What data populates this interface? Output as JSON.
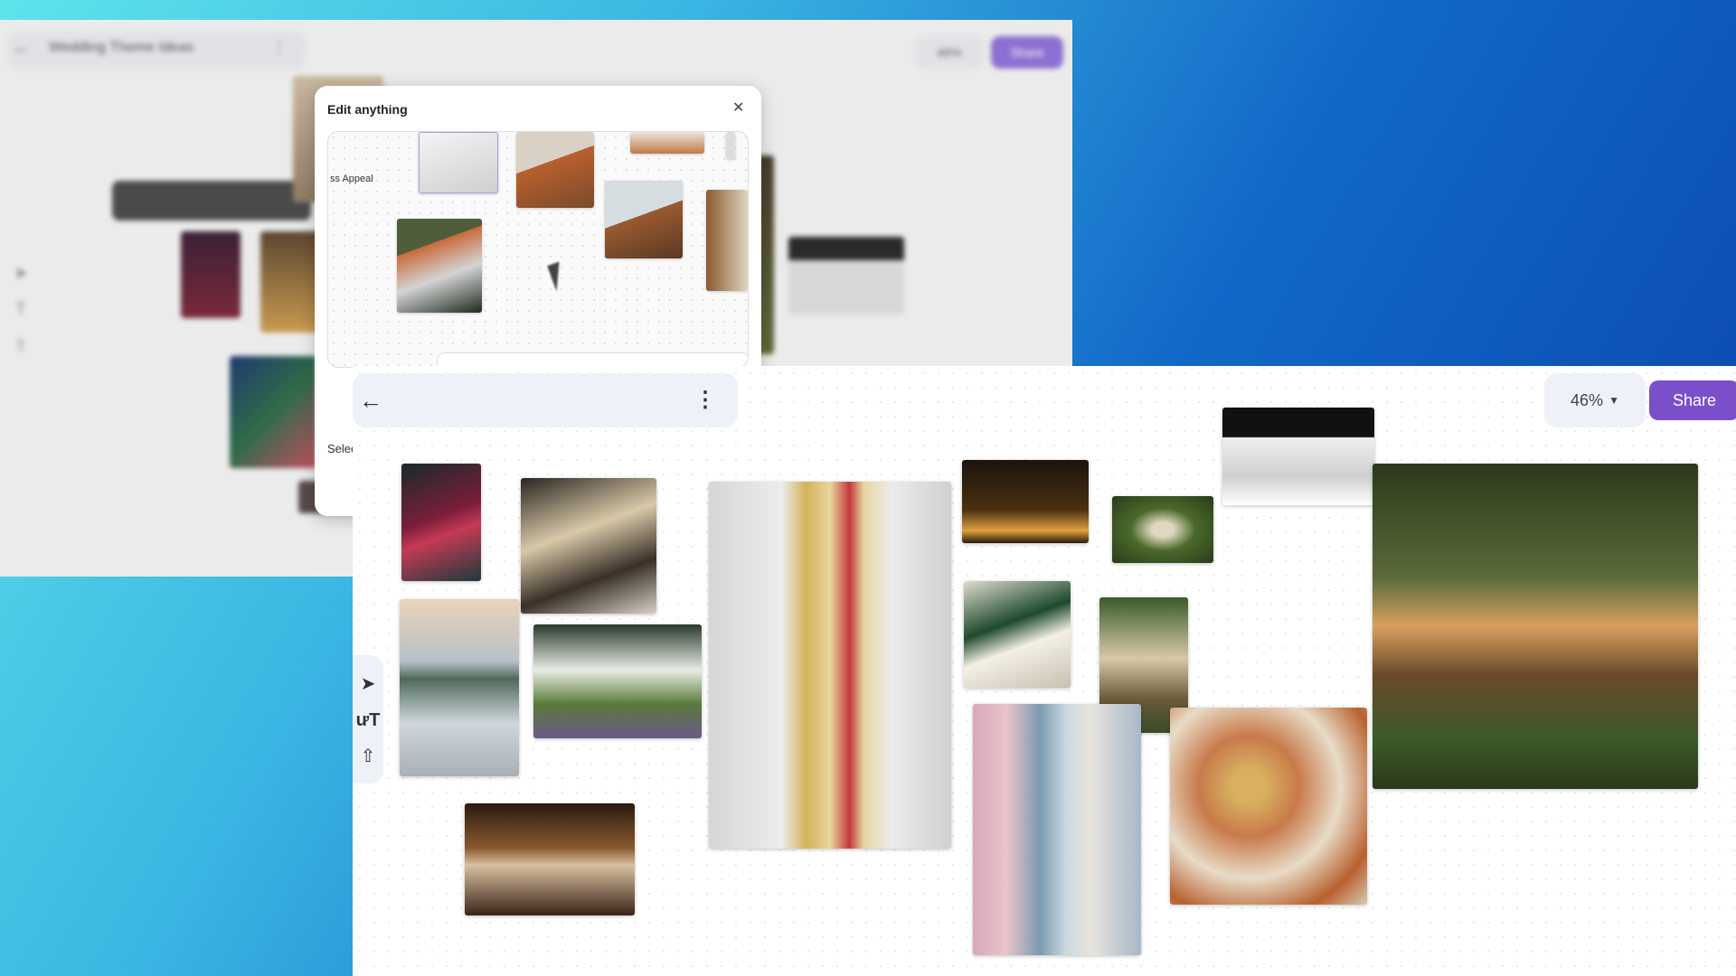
{
  "background_window": {
    "title": "Wedding Theme Ideas",
    "zoom": "46%",
    "share_label": "Share"
  },
  "edit_dialog": {
    "title": "Edit anything",
    "close_icon": "close-icon",
    "partial_label": "ss Appeal",
    "footer_text": "Selec"
  },
  "foreground": {
    "back_icon": "arrow-left-icon",
    "more_icon": "more-vertical-icon",
    "zoom": "46%",
    "share_label": "Share",
    "tools": [
      "pointer-icon",
      "text-icon",
      "upload-icon"
    ]
  },
  "colors": {
    "accent": "#7b4fc9",
    "toolbar_bg": "#eef1f8"
  }
}
